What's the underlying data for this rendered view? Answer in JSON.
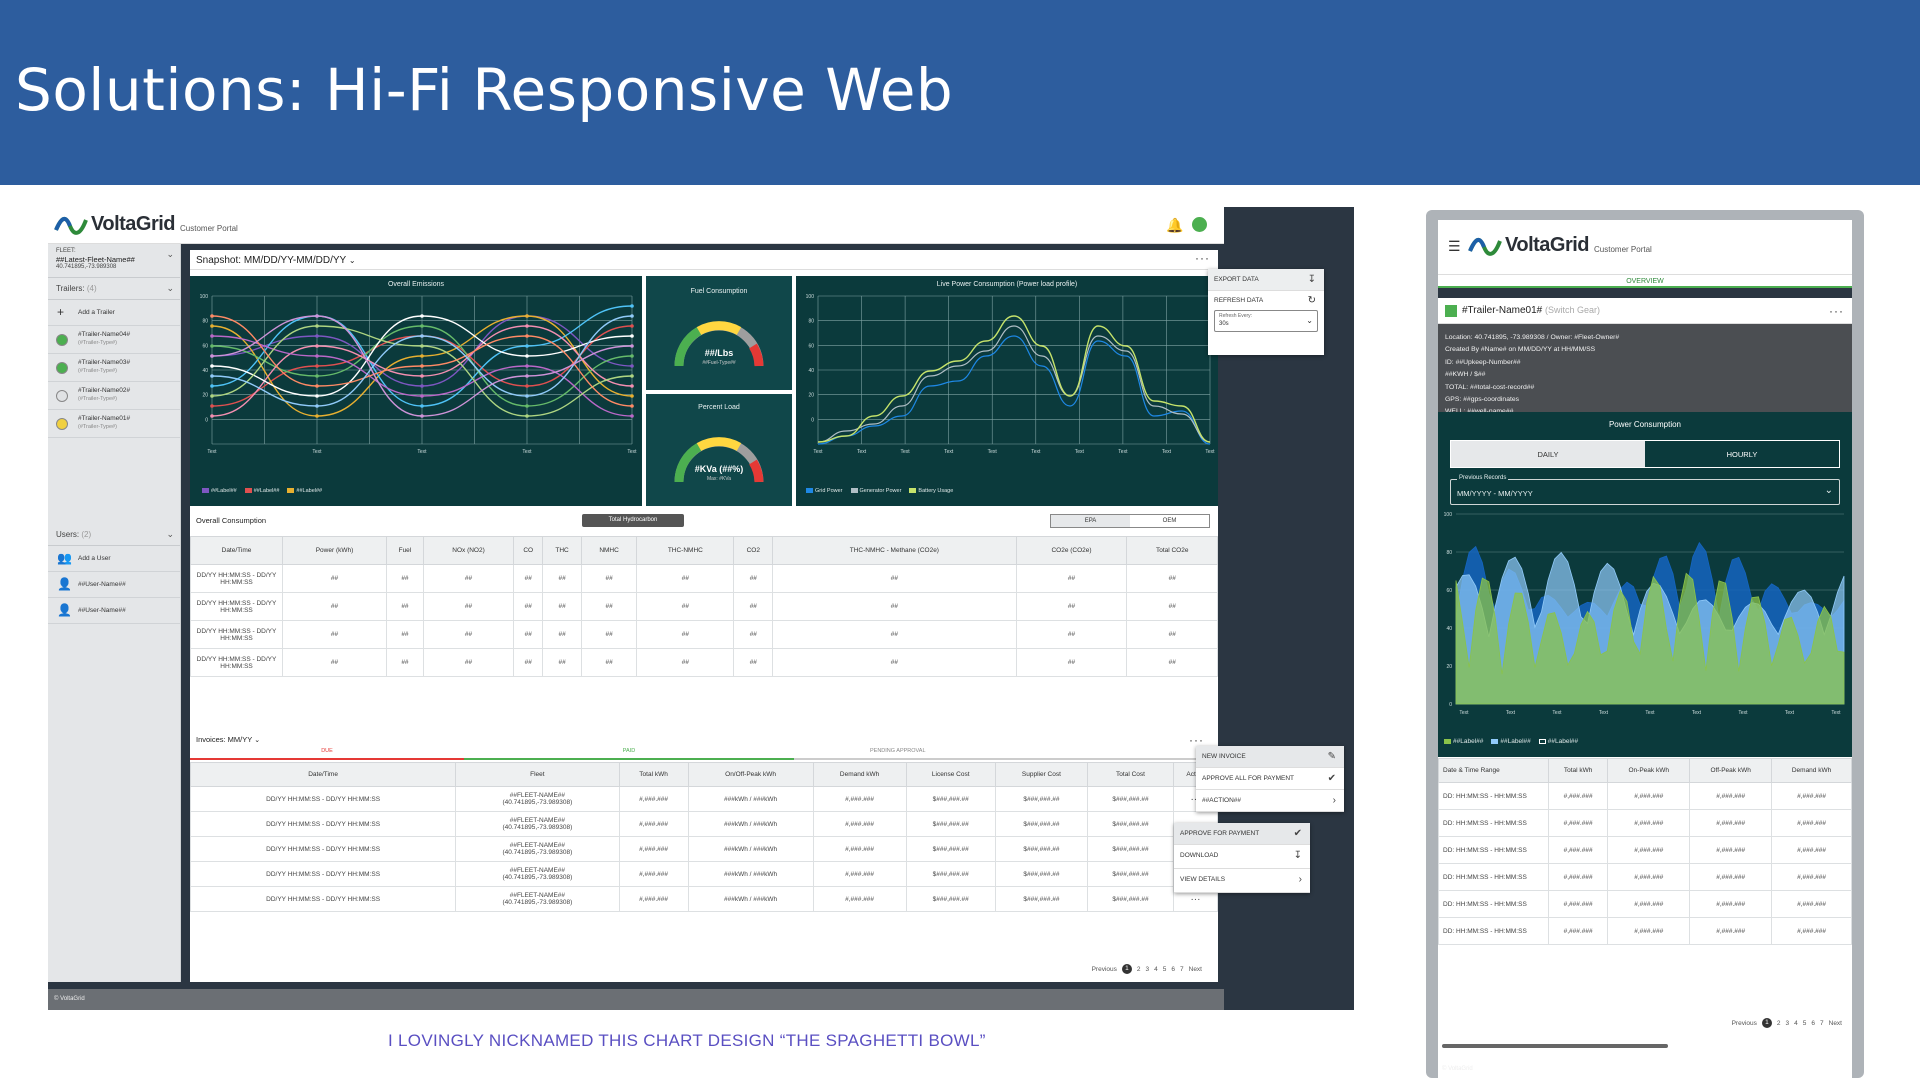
{
  "banner": {
    "title": "Solutions: Hi-Fi Responsive Web"
  },
  "brand": {
    "name": "VoltaGrid",
    "sub": "Customer Portal",
    "footer": "© VoltaGrid"
  },
  "sidebar": {
    "fleet_label": "FLEET:",
    "fleet_name": "##Latest-Fleet-Name##",
    "fleet_coords": "40.741895,-73.989308",
    "trailers_label": "Trailers:",
    "trailers_count": "(4)",
    "add_trailer": "Add a Trailer",
    "trailers": [
      {
        "name": "#Trailer-Name04#",
        "type": "(#Trailer-Type#)",
        "color": "#4caf50"
      },
      {
        "name": "#Trailer-Name03#",
        "type": "(#Trailer-Type#)",
        "color": "#4caf50"
      },
      {
        "name": "#Trailer-Name02#",
        "type": "(#Trailer-Type#)",
        "color": "#e0e2e4"
      },
      {
        "name": "#Trailer-Name01#",
        "type": "(#Trailer-Type#)",
        "color": "#f0d040"
      }
    ],
    "users_label": "Users:",
    "users_count": "(2)",
    "add_user": "Add a User",
    "users": [
      "##User-Name##",
      "##User-Name##"
    ]
  },
  "snapshot": {
    "title": "Snapshot: MM/DD/YY-MM/DD/YY",
    "emissions_title": "Overall Emissions",
    "emissions_legend": [
      "##Label##",
      "##Label##",
      "##Label##"
    ],
    "fuel_title": "Fuel Consumption",
    "fuel_value": "##/Lbs",
    "fuel_sub": "##Fuel-Type##",
    "load_title": "Percent Load",
    "load_value": "#KVa (##%)",
    "load_sub": "Max: #KVa",
    "power_title": "Live Power Consumption (Power load profile)",
    "power_legend": [
      "Grid Power",
      "Generator Power",
      "Battery Usage"
    ],
    "x_ticks": [
      "Text",
      "Text",
      "Text",
      "Text",
      "Text"
    ],
    "y_ticks": [
      "100",
      "80",
      "60",
      "40",
      "20",
      "0"
    ],
    "export": "EXPORT DATA",
    "refresh": "REFRESH DATA",
    "refresh_every": "Refresh Every:",
    "refresh_value": "30s"
  },
  "consumption": {
    "title": "Overall Consumption",
    "tooltip": "Total Hydrocarbon",
    "toggle": [
      "EPA",
      "OEM"
    ],
    "headers": [
      "Date/Time",
      "Power (kWh)",
      "Fuel",
      "NOx (NO2)",
      "CO",
      "THC",
      "NMHC",
      "THC-NMHC",
      "CO2",
      "THC-NMHC - Methane (CO2e)",
      "CO2e (CO2e)",
      "Total CO2e"
    ],
    "date": "DD/YY HH:MM:SS - DD/YY HH:MM:SS",
    "cell": "##"
  },
  "invoices": {
    "title": "Invoices: MM/YY",
    "tabs": [
      "DUE",
      "PAID",
      "PENDING APPROVAL"
    ],
    "headers": [
      "Date/Time",
      "Fleet",
      "Total kWh",
      "On/Off-Peak kWh",
      "Demand kWh",
      "License Cost",
      "Supplier Cost",
      "Total Cost",
      "Action"
    ],
    "date": "DD/YY HH:MM:SS - DD/YY HH:MM:SS",
    "fleet": "##FLEET-NAME##",
    "fleet_coords": "(40.741895,-73.989308)",
    "kwh": "#,###.###",
    "peak": "###kWh / ###kWh",
    "demand": "#,###.###",
    "cost": "$###,###.##",
    "menu": [
      "NEW INVOICE",
      "APPROVE ALL FOR PAYMENT",
      "##ACTION##"
    ],
    "row_menu": [
      "APPROVE FOR PAYMENT",
      "DOWNLOAD",
      "VIEW DETAILS"
    ],
    "pager": {
      "prev": "Previous",
      "pages": [
        "1",
        "2",
        "3",
        "4",
        "5",
        "6",
        "7"
      ],
      "next": "Next"
    }
  },
  "mobile": {
    "tab": "OVERVIEW",
    "trailer": "#Trailer-Name01#",
    "trailer_type": "(Switch Gear)",
    "info": [
      "Location: 40.741895, -73.989308 / Owner: #Fleet-Owner#",
      "Created By #Name# on MM/DD/YY at HH/MM/SS",
      "ID: ##Upkeep-Number##",
      "##KWH / $##",
      "TOTAL: ##total-cost-record##",
      "GPS: ##gps-coordinates",
      "WELL: ##well-name##"
    ],
    "pc_title": "Power Consumption",
    "seg": [
      "DAILY",
      "HOURLY"
    ],
    "prev_label": "Previous Records",
    "prev_value": "MM/YYYY - MM/YYYY",
    "legend": [
      "##Label##",
      "##Label##",
      "##Label##"
    ],
    "x_ticks": [
      "Text",
      "Text",
      "Text",
      "Text",
      "Text",
      "Text",
      "Text",
      "Text",
      "Text"
    ],
    "y_ticks": [
      "100",
      "80",
      "60",
      "40",
      "20",
      "0"
    ],
    "headers": [
      "Date & Time Range",
      "Total kWh",
      "On-Peak kWh",
      "Off-Peak kWh",
      "Demand kWh"
    ],
    "date": "DD: HH:MM:SS - HH:MM:SS",
    "val": "#,###.###",
    "pager": {
      "prev": "Previous",
      "pages": [
        "1",
        "2",
        "3",
        "4",
        "5",
        "6",
        "7"
      ],
      "next": "Next"
    },
    "footer": "© VoltaGrid"
  },
  "caption": "I LOVINGLY NICKNAMED THIS CHART DESIGN “THE SPAGHETTI BOWL”"
}
